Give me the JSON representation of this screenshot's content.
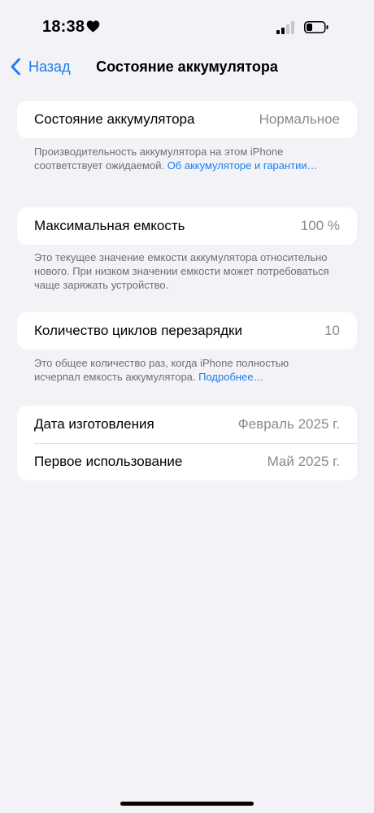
{
  "status_bar": {
    "time": "18:38",
    "icons": [
      "heart-icon",
      "cellular-signal-icon",
      "battery-icon"
    ]
  },
  "nav": {
    "back_label": "Назад",
    "title": "Состояние аккумулятора"
  },
  "sections": [
    {
      "rows": [
        {
          "label": "Состояние аккумулятора",
          "value": "Нормальное"
        }
      ],
      "footnote": {
        "text": "Производительность аккумулятора на этом iPhone соответствует ожидаемой. ",
        "link": "Об аккумуляторе и гаран­тии…"
      }
    },
    {
      "rows": [
        {
          "label": "Максимальная емкость",
          "value": "100 %"
        }
      ],
      "footnote": {
        "text": "Это текущее значение емкости аккумулятора относительно нового. При низком значении емкости может потребоваться чаще заряжать устройство."
      }
    },
    {
      "rows": [
        {
          "label": "Количество циклов перезарядки",
          "value": "10"
        }
      ],
      "footnote": {
        "text": "Это общее количество раз, когда iPhone полностью исчерпал емкость аккумулятора. ",
        "link": "Подробнее…"
      }
    },
    {
      "rows": [
        {
          "label": "Дата изготовления",
          "value": "Февраль 2025 г."
        },
        {
          "label": "Первое использование",
          "value": "Май 2025 г."
        }
      ]
    }
  ],
  "colors": {
    "background": "#f2f2f7",
    "card": "#ffffff",
    "accent": "#1a7ef0",
    "secondary_text": "#8a8a8e",
    "footnote_text": "#6e6e73"
  }
}
